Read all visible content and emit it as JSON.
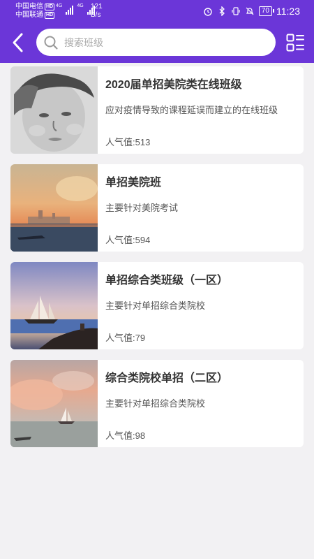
{
  "status_bar": {
    "carrier_1": "中国电信",
    "carrier_2": "中国联通",
    "hd_badge": "HD",
    "net_1": "4G",
    "net_2": "4G",
    "speed_value": "121",
    "speed_unit": "B/s",
    "battery": "70",
    "time": "11:23"
  },
  "header": {
    "back_icon": "chevron-left-icon",
    "menu_icon": "grid-list-icon"
  },
  "search": {
    "placeholder": "搜索班级",
    "value": ""
  },
  "classes": [
    {
      "title": "2020届单招美院类在线班级",
      "description": "应对疫情导致的课程延误而建立的在线班级",
      "popularity": "人气值:513",
      "image": "child-pencil-drawing"
    },
    {
      "title": "单招美院班",
      "description": "主要针对美院考试",
      "popularity": "人气值:594",
      "image": "sunset-harbor-painting"
    },
    {
      "title": "单招综合类班级（一区）",
      "description": "主要针对单招综合类院校",
      "popularity": "人气值:79",
      "image": "sailing-ship-painting"
    },
    {
      "title": "综合类院校单招（二区）",
      "description": "主要针对单招综合类院校",
      "popularity": "人气值:98",
      "image": "pink-sky-sailboat-painting"
    }
  ]
}
